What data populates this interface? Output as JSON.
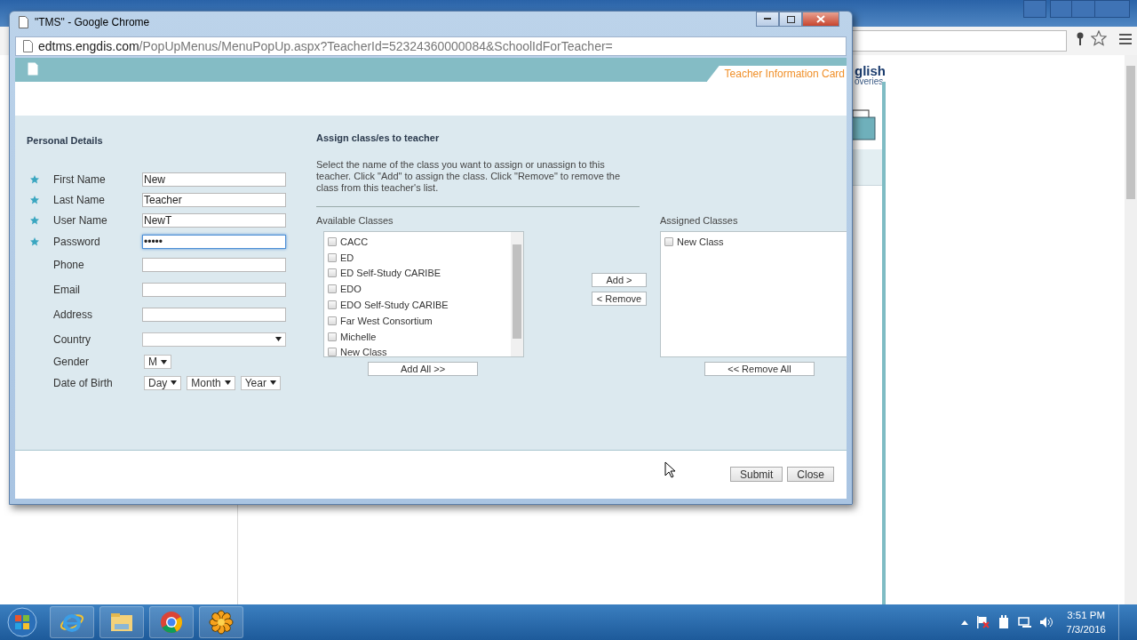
{
  "background_page": {
    "logo_lines": [
      "glish",
      "overies"
    ]
  },
  "popup": {
    "title": "\"TMS\" - Google Chrome",
    "url_host": "edtms.engdis.com",
    "url_path": "/PopUpMenus/MenuPopUp.aspx?TeacherId=52324360000084&SchoolIdForTeacher=",
    "header_tab": "Teacher Information Card",
    "personal": {
      "heading": "Personal Details",
      "fields": [
        {
          "label": "First Name",
          "required": true,
          "kind": "text",
          "value": "New"
        },
        {
          "label": "Last Name",
          "required": true,
          "kind": "text",
          "value": "Teacher"
        },
        {
          "label": "User Name",
          "required": true,
          "kind": "text",
          "value": "NewT"
        },
        {
          "label": "Password",
          "required": true,
          "kind": "text",
          "value": "•••••",
          "focused": true
        },
        {
          "label": "Phone",
          "required": false,
          "kind": "text"
        },
        {
          "label": "Email",
          "required": false,
          "kind": "text"
        },
        {
          "label": "Address",
          "required": false,
          "kind": "text"
        },
        {
          "label": "Country",
          "required": false,
          "kind": "select"
        },
        {
          "label": "Gender",
          "required": false,
          "kind": "select_small",
          "selects": [
            "M"
          ]
        },
        {
          "label": "Date of Birth",
          "required": false,
          "kind": "selects",
          "selects": [
            "Day",
            "Month",
            "Year"
          ]
        }
      ]
    },
    "assign": {
      "heading": "Assign class/es to teacher",
      "description": "Select the name of the class you want to assign or unassign to this teacher. Click \"Add\" to assign the class. Click \"Remove\" to remove the class from this teacher's list.",
      "available": {
        "label": "Available Classes",
        "button": "Add All >>",
        "items": [
          {
            "name": "CACC",
            "checked": false
          },
          {
            "name": "ED",
            "checked": false
          },
          {
            "name": "ED Self-Study CARIBE",
            "checked": false
          },
          {
            "name": "EDO",
            "checked": false
          },
          {
            "name": "EDO Self-Study CARIBE",
            "checked": false
          },
          {
            "name": "Far West Consortium",
            "checked": false
          },
          {
            "name": "Michelle",
            "checked": false
          },
          {
            "name": "New Class",
            "checked": false
          }
        ]
      },
      "middle_buttons": [
        "Add >",
        "< Remove"
      ],
      "assigned": {
        "label": "Assigned Classes",
        "button": "<< Remove All",
        "items": [
          {
            "name": "New Class",
            "checked": false
          }
        ]
      }
    },
    "footer_buttons": [
      "Submit",
      "Close"
    ]
  },
  "taskbar": {
    "time": "3:51 PM",
    "date": "7/3/2016"
  }
}
